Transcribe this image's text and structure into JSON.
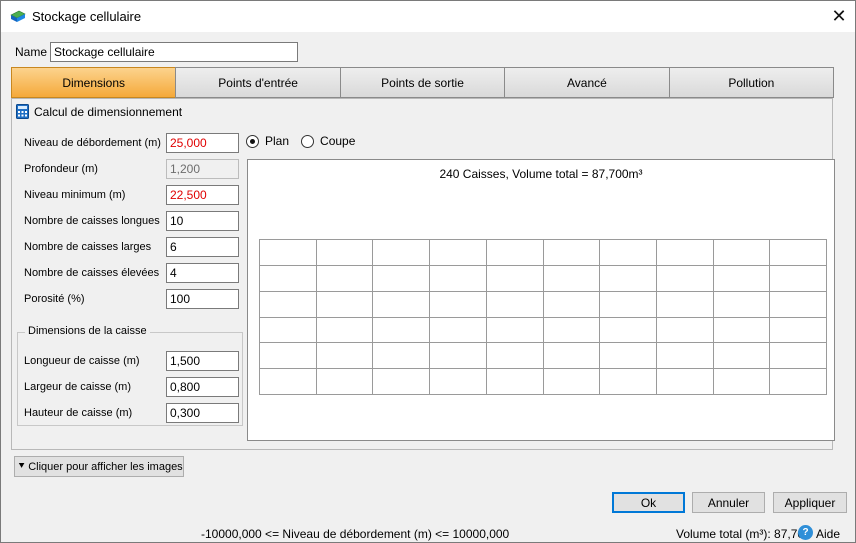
{
  "window": {
    "title": "Stockage cellulaire",
    "icon": "storage-app-icon",
    "close_glyph": "✕"
  },
  "name_field": {
    "label": "Name",
    "value": "Stockage cellulaire"
  },
  "tabs": [
    {
      "label": "Dimensions",
      "active": true
    },
    {
      "label": "Points d'entrée",
      "active": false
    },
    {
      "label": "Points de sortie",
      "active": false
    },
    {
      "label": "Avancé",
      "active": false
    },
    {
      "label": "Pollution",
      "active": false
    }
  ],
  "section": {
    "title": "Calcul de dimensionnement",
    "icon": "calculator-icon"
  },
  "fields": [
    {
      "label": "Niveau de débordement (m)",
      "value": "25,000",
      "style": "red"
    },
    {
      "label": "Profondeur (m)",
      "value": "1,200",
      "style": "disabled"
    },
    {
      "label": "Niveau minimum (m)",
      "value": "22,500",
      "style": "red"
    },
    {
      "label": "Nombre de caisses longues",
      "value": "10",
      "style": "normal"
    },
    {
      "label": "Nombre de caisses larges",
      "value": "6",
      "style": "normal"
    },
    {
      "label": "Nombre de caisses élevées",
      "value": "4",
      "style": "normal"
    },
    {
      "label": "Porosité (%)",
      "value": "100",
      "style": "normal"
    }
  ],
  "box_dimensions": {
    "title": "Dimensions de la caisse",
    "fields": [
      {
        "label": "Longueur de caisse (m)",
        "value": "1,500"
      },
      {
        "label": "Largeur de caisse (m)",
        "value": "0,800"
      },
      {
        "label": "Hauteur de caisse (m)",
        "value": "0,300"
      }
    ]
  },
  "view_mode": {
    "options": [
      "Plan",
      "Coupe"
    ],
    "selected": "Plan"
  },
  "canvas": {
    "caption": "240 Caisses, Volume total = 87,700m³",
    "grid_columns": 10,
    "grid_rows": 6
  },
  "images_button": {
    "label": "Cliquer pour afficher les images"
  },
  "buttons": {
    "ok": "Ok",
    "cancel": "Annuler",
    "apply": "Appliquer"
  },
  "status": {
    "constraint": "-10000,000 <= Niveau de débordement (m) <= 10000,000",
    "volume": "Volume total (m³): 87,700",
    "help": "Aide"
  },
  "colors": {
    "active_tab": "#f5a93a",
    "invalid_value": "#e00000",
    "help_icon": "#2f8fd8"
  }
}
